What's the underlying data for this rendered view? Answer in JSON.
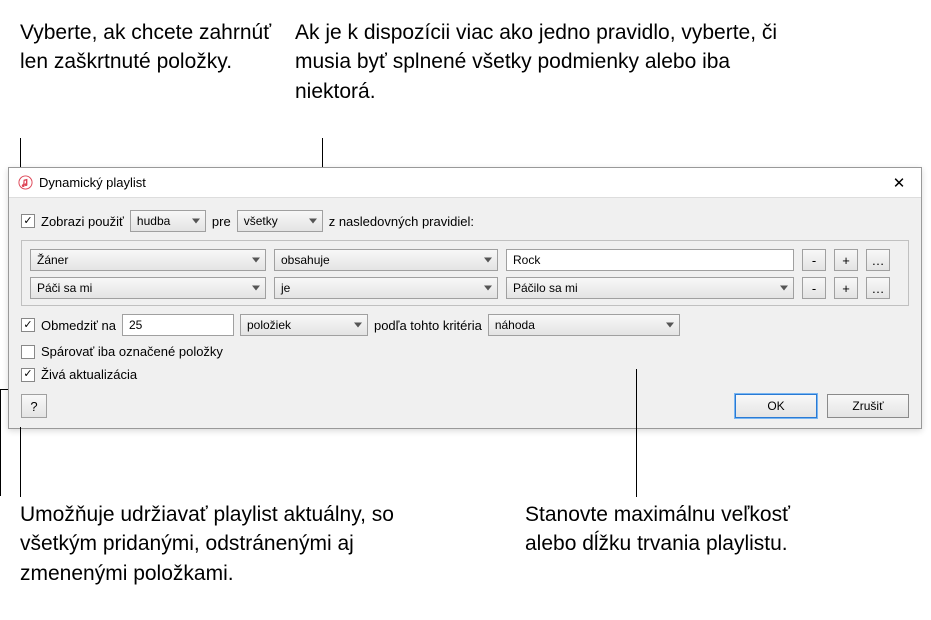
{
  "annotations": {
    "topLeft": "Vyberte, ak chcete zahrnúť len zaškrtnuté položky.",
    "topRight": "Ak je k dispozícii viac ako jedno pravidlo, vyberte, či musia byť splnené všetky podmienky alebo iba niektorá.",
    "bottomLeft": "Umožňuje udržiavať playlist aktuálny, so všetkým pridanými, odstránenými aj zmenenými položkami.",
    "bottomRight": "Stanovte maximálnu veľkosť alebo dĺžku trvania playlistu."
  },
  "dialog": {
    "title": "Dynamický playlist",
    "matchRow": {
      "checkboxLabel": "Zobrazi použiť",
      "mediaType": "hudba",
      "forLabel": "pre",
      "matchType": "všetky",
      "suffix": "z nasledovných pravidiel:"
    },
    "rules": [
      {
        "field": "Žáner",
        "operator": "obsahuje",
        "value": "Rock",
        "valueType": "text"
      },
      {
        "field": "Páči sa mi",
        "operator": "je",
        "value": "Páčilo sa mi",
        "valueType": "select"
      }
    ],
    "limit": {
      "label": "Obmedziť na",
      "value": "25",
      "unit": "položiek",
      "byLabel": "podľa tohto kritéria",
      "criteria": "náhoda"
    },
    "matchOnlyChecked": "Spárovať iba označené položky",
    "liveUpdating": "Živá aktualizácia",
    "buttons": {
      "help": "?",
      "ok": "OK",
      "cancel": "Zrušiť"
    }
  }
}
